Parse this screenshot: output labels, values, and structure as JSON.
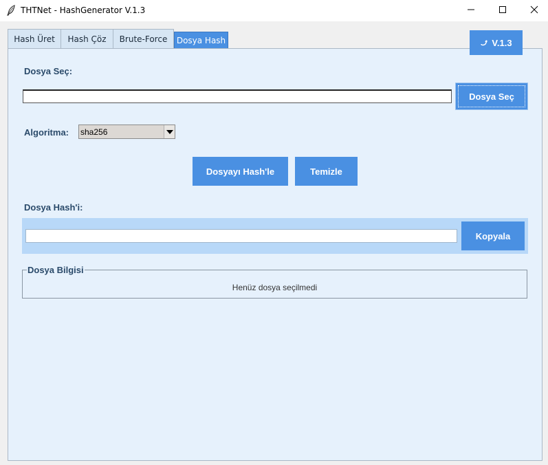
{
  "window": {
    "title": "THTNet - HashGenerator V.1.3",
    "icon": "feather-icon"
  },
  "tabs": [
    {
      "label": "Hash Üret",
      "active": false
    },
    {
      "label": "Hash Çöz",
      "active": false
    },
    {
      "label": "Brute-Force",
      "active": false
    },
    {
      "label": "Dosya Hash",
      "active": true
    }
  ],
  "version_badge": {
    "label": "V.1.3",
    "icon": "hand-icon"
  },
  "file_select": {
    "label": "Dosya Seç:",
    "path_value": "",
    "button_label": "Dosya Seç"
  },
  "algorithm": {
    "label": "Algoritma:",
    "selected": "sha256"
  },
  "actions": {
    "hash_button": "Dosyayı Hash'le",
    "clear_button": "Temizle"
  },
  "file_hash": {
    "label": "Dosya Hash'i:",
    "value": "",
    "copy_button": "Kopyala"
  },
  "file_info": {
    "legend": "Dosya Bilgisi",
    "status": "Henüz dosya seçilmedi"
  },
  "colors": {
    "accent": "#4a90e2",
    "panel_bg": "#e6f1fc",
    "label_text": "#2a4a6a",
    "hash_strip": "#b8d8f8"
  }
}
